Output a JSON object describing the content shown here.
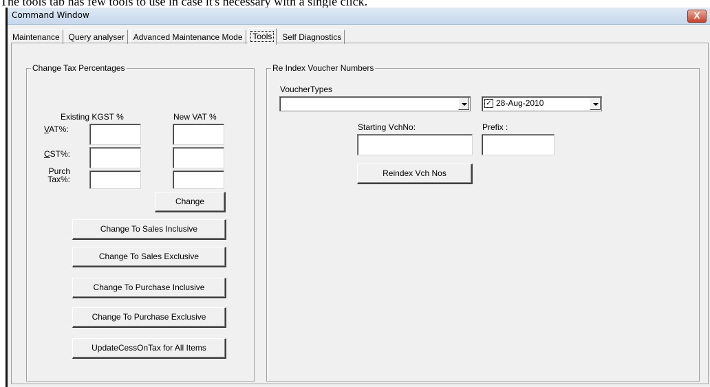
{
  "caption": "The tools tab has few tools to use in case it's necessary with a single click.",
  "window": {
    "title": "Command Window",
    "close_glyph": "X"
  },
  "tabs": [
    {
      "label": "Maintenance"
    },
    {
      "label": "Query analyser"
    },
    {
      "label": "Advanced Maintenance Mode"
    },
    {
      "label": "Tools",
      "active": true
    },
    {
      "label": "Self Diagnostics"
    }
  ],
  "tax_group": {
    "title": "Change Tax Percentages",
    "col_existing": "Existing KGST %",
    "col_new": "New VAT %",
    "rows": [
      {
        "label": "VAT%:",
        "existing": "",
        "new": ""
      },
      {
        "label": "CST%:",
        "existing": "",
        "new": ""
      },
      {
        "label": "Purch Tax%:",
        "existing": "",
        "new": ""
      }
    ],
    "change_button": "Change",
    "buttons": [
      "Change To Sales Inclusive",
      "Change To Sales Exclusive",
      "Change To Purchase Inclusive",
      "Change To Purchase Exclusive",
      "UpdateCessOnTax for All Items"
    ]
  },
  "reindex_group": {
    "title": "Re Index Voucher Numbers",
    "voucher_types_label": "VoucherTypes",
    "voucher_type_value": "",
    "date_checked": true,
    "date_value": "28-Aug-2010",
    "starting_label": "Starting VchNo:",
    "starting_value": "",
    "prefix_label": "Prefix :",
    "prefix_value": "",
    "reindex_button": "Reindex Vch Nos"
  },
  "colors": {
    "window_bg": "#f0f0f0",
    "close_button": "#c7432c"
  }
}
